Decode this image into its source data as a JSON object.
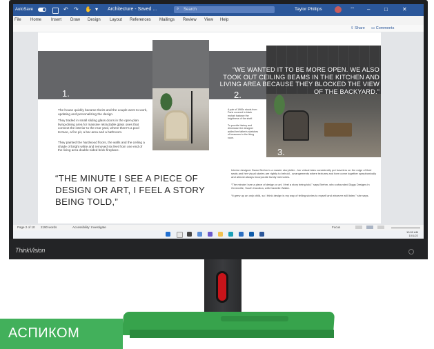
{
  "titlebar": {
    "autosave": "AutoSave",
    "toggle": "On",
    "doc_title": "Architecture - Saved ...",
    "search": "Search",
    "user": "Taylor Phillips"
  },
  "menu": [
    "File",
    "Home",
    "Insert",
    "Draw",
    "Design",
    "Layout",
    "References",
    "Mailings",
    "Review",
    "View",
    "Help"
  ],
  "ribbon": {
    "share": "Share",
    "comments": "Comments"
  },
  "doc": {
    "num1": "1.",
    "num2": "2.",
    "num3": "3.",
    "quote_top": "“WE WANTED IT TO BE MORE OPEN. WE ALSO TOOK OUT CEILING BEAMS IN THE KITCHEN AND LIVING AREA BECAUSE THEY BLOCKED THE VIEW OF THE BACKYARD.”",
    "quote_big": "“THE MINUTE I SEE A PIECE OF DESIGN OR ART, I FEEL A STORY BEING TOLD,”",
    "col1_p1": "The house quickly became theirs and the couple went to work, updating and personalizing the design.",
    "col1_p2": "They traded in small sliding glass doors in the open-plan living-dining area for massive retractable glass ones that connect the interior to the rear yard, where there's a pool terrace, a fire pit, a bar area and a bathroom.",
    "col1_p3": "They painted the hardwood floors, the walls and the ceiling a shade of bright white and removed six feet from one end of the living area double-sided brick fireplace.",
    "col2_p1": "A pair of 1960s stools from Paris covered in black mohair balance the brightness of the shelf.",
    "col2_p2": "To provide history and dimension the designer added her father's sketches of treasures to the living room.",
    "col3_p1": "Interior designer Dawn Brehm is a master storyteller - her virtual tales consistently put travelers on the edge of their seats and her visual stories are rightly to behold - arrangements where textures and form come together symphonically and almost always incorporate family memories.",
    "col3_p2": "“The minute I see a piece of design or art, I feel a story being told,” says Brehm, who cofounded Diggs Designs in Greenville, South Carolina, with Danielle Walter.",
    "col3_p3": "“It grew up an only child, so I think design is my way of telling stories to myself and whoever will listen,” she says."
  },
  "status": {
    "page": "Page 2 of 10",
    "words": "2190 words",
    "accessibility": "Accessibility: Investigate",
    "focus": "Focus",
    "time": "10:00 AM",
    "date": "10/1/22"
  },
  "monitor": {
    "brand": "ThinkVision"
  },
  "banner": {
    "text": "АСПИКОМ"
  },
  "colors": {
    "word_blue": "#2b579a",
    "banner_green": "#42b05b",
    "stand_red": "#c8141a"
  },
  "icons": [
    "undo-icon",
    "redo-icon",
    "save-icon",
    "search-icon",
    "share-icon",
    "comments-icon",
    "windows-start-icon",
    "edge-icon",
    "word-icon",
    "power-led-icon"
  ]
}
